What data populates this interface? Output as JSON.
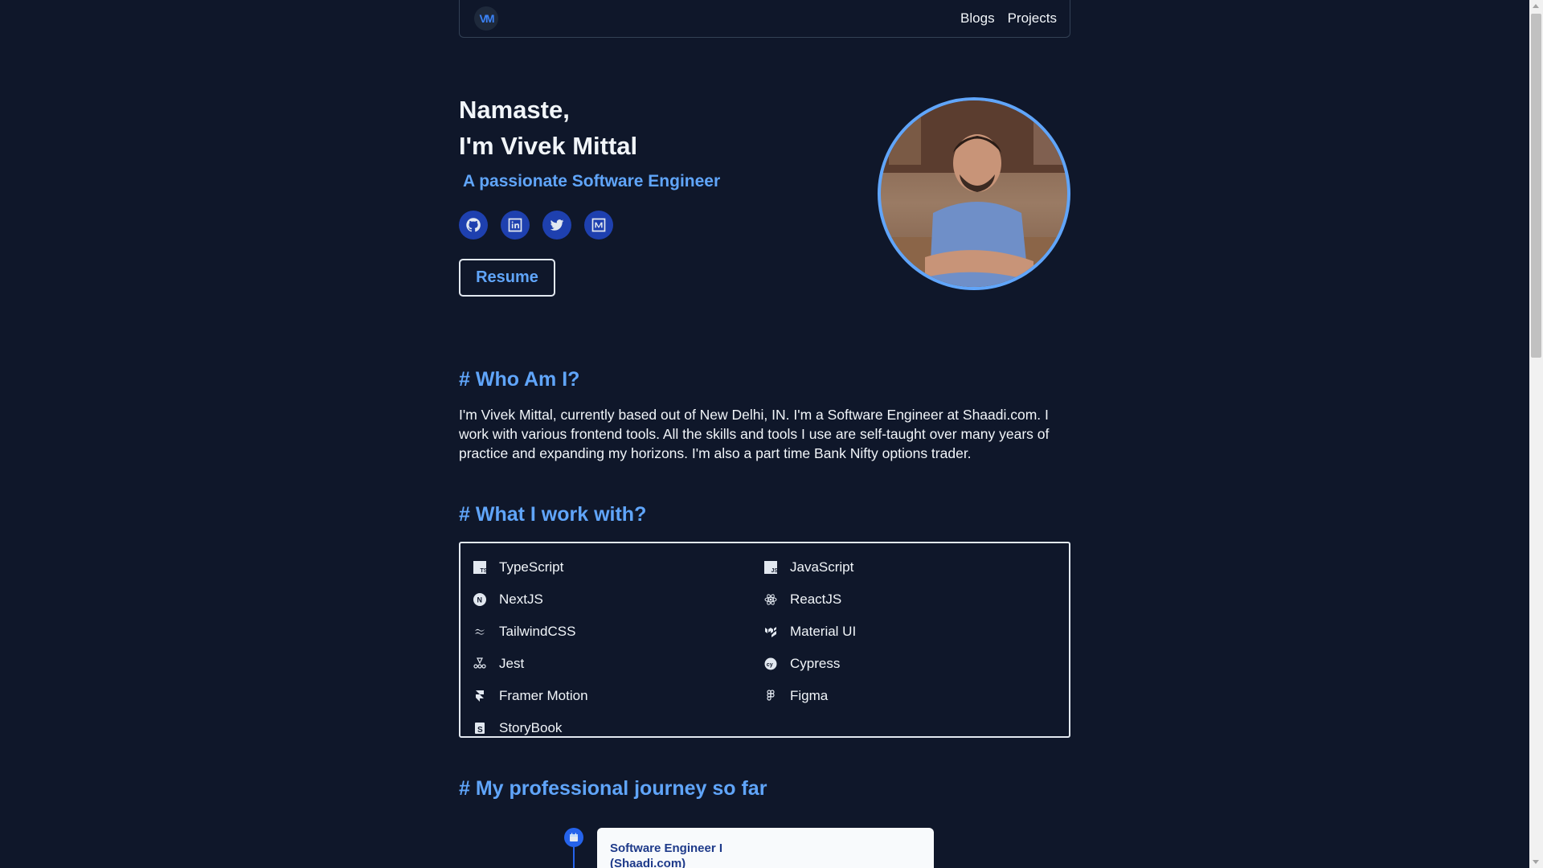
{
  "nav": {
    "logo_text": "VM",
    "links": [
      "Blogs",
      "Projects"
    ]
  },
  "hero": {
    "greeting_line1": "Namaste,",
    "greeting_line2": "I'm Vivek Mittal",
    "subtitle": "A passionate Software Engineer",
    "socials": [
      "github-icon",
      "linkedin-icon",
      "twitter-icon",
      "medium-icon"
    ],
    "resume_label": "Resume"
  },
  "about": {
    "title": "# Who Am I?",
    "text": "I'm Vivek Mittal, currently based out of New Delhi, IN. I'm a Software Engineer at Shaadi.com. I work with various frontend tools. All the skills and tools I use are self-taught over many years of practice and expanding my horizons. I'm also a part time Bank Nifty options trader."
  },
  "skills": {
    "title": "# What I work with?",
    "items": [
      {
        "label": "TypeScript",
        "icon": "typescript-icon"
      },
      {
        "label": "JavaScript",
        "icon": "javascript-icon"
      },
      {
        "label": "NextJS",
        "icon": "nextjs-icon"
      },
      {
        "label": "ReactJS",
        "icon": "react-icon"
      },
      {
        "label": "TailwindCSS",
        "icon": "tailwind-icon"
      },
      {
        "label": "Material UI",
        "icon": "material-ui-icon"
      },
      {
        "label": "Jest",
        "icon": "jest-icon"
      },
      {
        "label": "Cypress",
        "icon": "cypress-icon"
      },
      {
        "label": "Framer Motion",
        "icon": "framer-icon"
      },
      {
        "label": "Figma",
        "icon": "figma-icon"
      },
      {
        "label": "StoryBook",
        "icon": "storybook-icon"
      }
    ]
  },
  "journey": {
    "title": "# My professional journey so far",
    "entries": [
      {
        "role": "Software Engineer I",
        "company": "(Shaadi.com)"
      }
    ]
  },
  "colors": {
    "background": "#0f172a",
    "accent": "#60a5fa",
    "social_bg": "#1e40af"
  }
}
